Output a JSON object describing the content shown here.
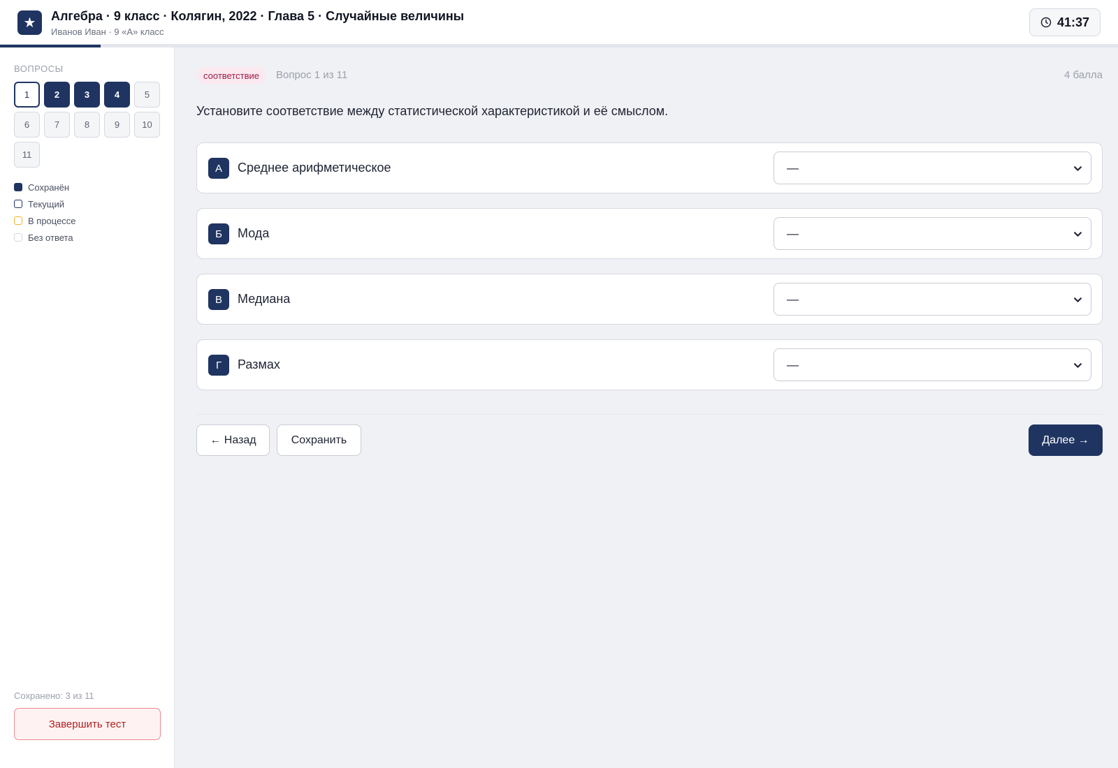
{
  "header": {
    "logo_glyph": "★",
    "title": "Алгебра · 9 класс · Колягин, 2022 · Глава 5 · Случайные величины",
    "subtitle": "Иванов Иван · 9 «А» класс",
    "timer": "41:37",
    "timer_icon": "clock-icon",
    "progress_fraction": 0.09
  },
  "sidebar": {
    "section_title": "ВОПРОСЫ",
    "questions": [
      {
        "label": "1",
        "state": "current"
      },
      {
        "label": "2",
        "state": "saved"
      },
      {
        "label": "3",
        "state": "saved"
      },
      {
        "label": "4",
        "state": "saved"
      },
      {
        "label": "5",
        "state": "empty"
      },
      {
        "label": "6",
        "state": "empty"
      },
      {
        "label": "7",
        "state": "empty"
      },
      {
        "label": "8",
        "state": "empty"
      },
      {
        "label": "9",
        "state": "empty"
      },
      {
        "label": "10",
        "state": "empty"
      },
      {
        "label": "11",
        "state": "empty"
      }
    ],
    "legend": [
      {
        "label": "Сохранён",
        "state": "saved"
      },
      {
        "label": "Текущий",
        "state": "current"
      },
      {
        "label": "В процессе",
        "state": "progress"
      },
      {
        "label": "Без ответа",
        "state": "empty"
      }
    ],
    "saved_count": "Сохранено: 3 из 11",
    "finish_label": "Завершить тест"
  },
  "question": {
    "type_label": "соответствие",
    "counter": "Вопрос 1 из 11",
    "points": "4 балла",
    "text": "Установите соответствие между статистической характеристикой и её смыслом.",
    "rows": [
      {
        "letter": "А",
        "term": "Среднее арифметическое",
        "selected": "—"
      },
      {
        "letter": "Б",
        "term": "Мода",
        "selected": "—"
      },
      {
        "letter": "В",
        "term": "Медиана",
        "selected": "—"
      },
      {
        "letter": "Г",
        "term": "Размах",
        "selected": "—"
      }
    ]
  },
  "navigation": {
    "back_label": "← Назад",
    "save_label": "Сохранить",
    "next_label": "Далее →"
  },
  "colors": {
    "accent": "#1f3461",
    "danger": "#b21f1f",
    "in_progress": "#f0b429"
  }
}
